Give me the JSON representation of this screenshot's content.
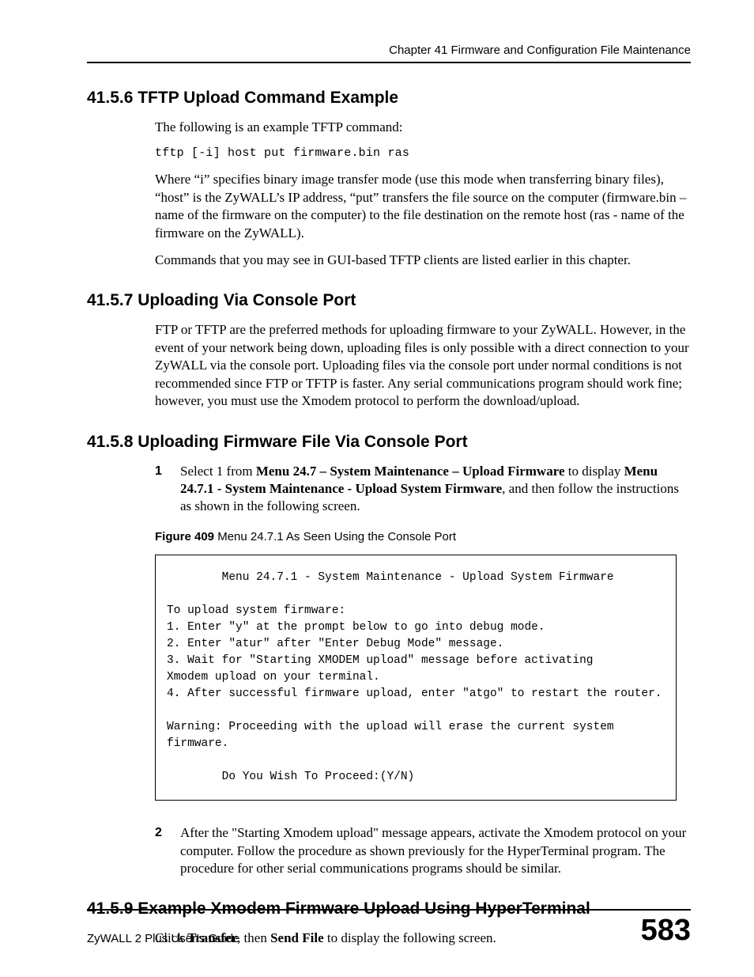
{
  "header": {
    "chapter": "Chapter 41 Firmware and Configuration File Maintenance"
  },
  "s6": {
    "heading": "41.5.6  TFTP Upload Command Example",
    "p1": "The following is an example TFTP command:",
    "code": "tftp [-i] host put firmware.bin ras",
    "p2": "Where “i” specifies binary image transfer mode (use this mode when transferring binary files), “host” is the ZyWALL’s IP address, “put” transfers the file source on the computer (firmware.bin – name of the firmware on the computer) to the file destination on the remote host (ras - name of the firmware on the ZyWALL).",
    "p3": "Commands that you may see in GUI-based TFTP clients are listed earlier in this chapter."
  },
  "s7": {
    "heading": "41.5.7  Uploading Via Console Port",
    "p1": "FTP or TFTP are the preferred methods for uploading firmware to your ZyWALL. However, in the event of your network being down, uploading files is only possible with a direct connection to your ZyWALL via the console port. Uploading files via the console port under normal conditions is not recommended since FTP or TFTP is faster. Any serial communications program should work fine; however, you must use the Xmodem protocol to perform the download/upload."
  },
  "s8": {
    "heading": "41.5.8  Uploading Firmware File Via Console Port",
    "step1_num": "1",
    "step1_pre": "Select 1 from ",
    "step1_b1": "Menu 24.7 – System Maintenance – Upload Firmware",
    "step1_mid": " to display ",
    "step1_b2": "Menu 24.7.1 - System Maintenance - Upload System Firmware",
    "step1_post": ", and then follow the instructions as shown in the following screen.",
    "fig_label": "Figure 409",
    "fig_caption": "   Menu 24.7.1 As Seen Using the Console Port",
    "console": "        Menu 24.7.1 - System Maintenance - Upload System Firmware\n\nTo upload system firmware:\n1. Enter \"y\" at the prompt below to go into debug mode.\n2. Enter \"atur\" after \"Enter Debug Mode\" message.\n3. Wait for \"Starting XMODEM upload\" message before activating\nXmodem upload on your terminal.\n4. After successful firmware upload, enter \"atgo\" to restart the router.\n\nWarning: Proceeding with the upload will erase the current system\nfirmware.\n\n        Do You Wish To Proceed:(Y/N)",
    "step2_num": "2",
    "step2": "After the \"Starting Xmodem upload\" message appears, activate the Xmodem protocol on your computer. Follow the procedure as shown previously for the HyperTerminal program. The procedure for other serial communications programs should be similar."
  },
  "s9": {
    "heading": "41.5.9  Example Xmodem Firmware Upload Using HyperTerminal",
    "p1_pre": "Click ",
    "p1_b1": "Transfer",
    "p1_mid": ", then ",
    "p1_b2": "Send File",
    "p1_post": " to display the following screen."
  },
  "footer": {
    "left": "ZyWALL 2 Plus User’s Guide",
    "page": "583"
  }
}
